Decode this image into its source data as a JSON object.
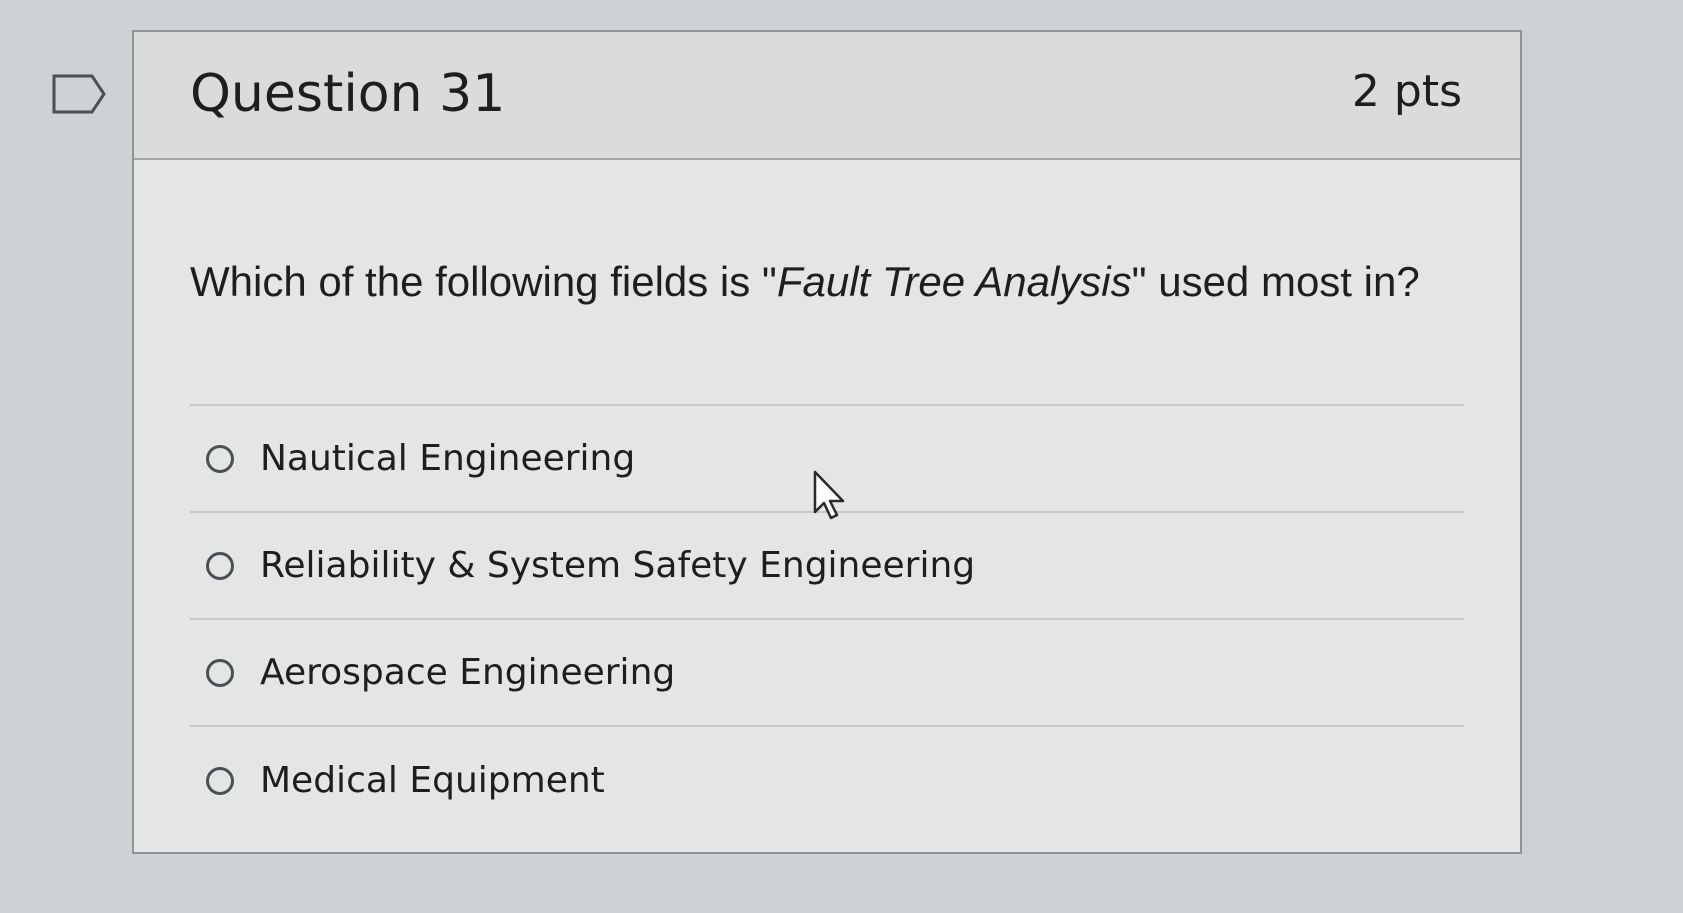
{
  "question": {
    "title": "Question 31",
    "points": "2 pts",
    "text_before": "Which of the following fields is \"",
    "text_italic": "Fault Tree Analysis",
    "text_after": "\" used most in?"
  },
  "answers": [
    {
      "label": "Nautical Engineering"
    },
    {
      "label": "Reliability & System Safety Engineering"
    },
    {
      "label": "Aerospace Engineering"
    },
    {
      "label": "Medical Equipment"
    }
  ],
  "icons": {
    "flag": "flag-outline-icon",
    "cursor": "mouse-pointer-icon"
  },
  "colors": {
    "background": "#cfd2d4",
    "card": "#e4e6e6",
    "header": "#dadcdc",
    "text": "#1e1e1e",
    "border": "#8e9498"
  }
}
